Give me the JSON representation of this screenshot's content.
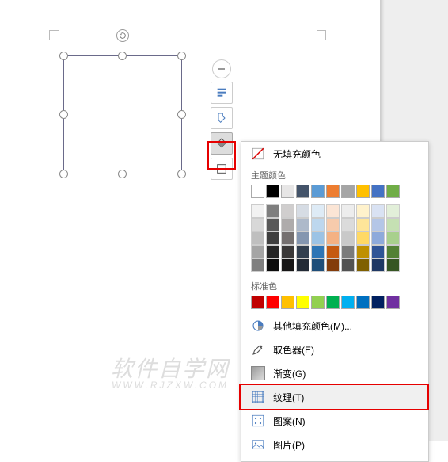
{
  "popup": {
    "no_fill": "无填充颜色",
    "theme_label": "主题颜色",
    "standard_label": "标准色",
    "more_fill": "其他填充颜色(M)...",
    "eyedropper": "取色器(E)",
    "gradient": "渐变(G)",
    "texture": "纹理(T)",
    "pattern": "图案(N)",
    "picture": "图片(P)"
  },
  "theme_colors_row1": [
    "#ffffff",
    "#000000",
    "#e7e6e6",
    "#44546a",
    "#5b9bd5",
    "#ed7d31",
    "#a5a5a5",
    "#ffc000",
    "#4472c4",
    "#70ad47"
  ],
  "theme_tints": [
    [
      "#f2f2f2",
      "#7f7f7f",
      "#d0cece",
      "#d6dce4",
      "#deebf6",
      "#fbe5d5",
      "#ededed",
      "#fff2cc",
      "#d9e2f3",
      "#e2efd9"
    ],
    [
      "#d8d8d8",
      "#595959",
      "#aeabab",
      "#adb9ca",
      "#bdd7ee",
      "#f7cbac",
      "#dbdbdb",
      "#fee599",
      "#b4c6e7",
      "#c5e0b3"
    ],
    [
      "#bfbfbf",
      "#3f3f3f",
      "#757070",
      "#8496b0",
      "#9cc3e5",
      "#f4b183",
      "#c9c9c9",
      "#ffd965",
      "#8eaadb",
      "#a8d08d"
    ],
    [
      "#a5a5a5",
      "#262626",
      "#3a3838",
      "#323f4f",
      "#2e75b5",
      "#c55a11",
      "#7b7b7b",
      "#bf9000",
      "#2f5496",
      "#538135"
    ],
    [
      "#7f7f7f",
      "#0c0c0c",
      "#171616",
      "#222a35",
      "#1e4e79",
      "#833c0b",
      "#525252",
      "#7f6000",
      "#1f3864",
      "#375623"
    ]
  ],
  "standard_colors": [
    "#c00000",
    "#ff0000",
    "#ffc000",
    "#ffff00",
    "#92d050",
    "#00b050",
    "#00b0f0",
    "#0070c0",
    "#002060",
    "#7030a0"
  ],
  "watermark": {
    "main": "软件自学网",
    "sub": "WWW.RJZXW.COM"
  },
  "chart_data": {
    "type": "table",
    "note": "not a chart"
  }
}
